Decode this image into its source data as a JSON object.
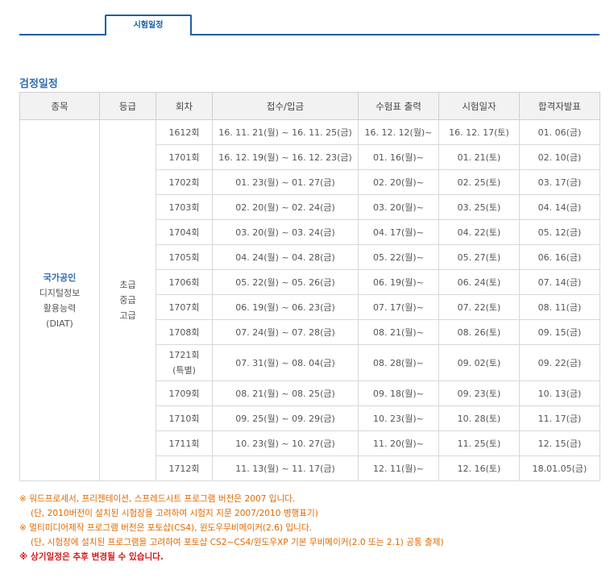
{
  "tab": {
    "label": "시험일정"
  },
  "section": {
    "title": "검정일정"
  },
  "table": {
    "headers": [
      "종목",
      "등급",
      "회차",
      "접수/입금",
      "수험표 출력",
      "시험일자",
      "합격자발표"
    ],
    "category": {
      "line1": "국가공인",
      "line2": "디지털정보",
      "line3": "활용능력",
      "line4": "(DIAT)"
    },
    "grade": {
      "line1": "초급",
      "line2": "중급",
      "line3": "고급"
    },
    "rows": [
      {
        "round": "1612회",
        "round2": "",
        "reg": "16. 11. 21(월) ~ 16. 11. 25(금)",
        "ticket": "16. 12. 12(월)~",
        "exam": "16. 12. 17(토)",
        "result": "01. 06(금)"
      },
      {
        "round": "1701회",
        "round2": "",
        "reg": "16. 12. 19(월) ~ 16. 12. 23(금)",
        "ticket": "01. 16(월)~",
        "exam": "01. 21(토)",
        "result": "02. 10(금)"
      },
      {
        "round": "1702회",
        "round2": "",
        "reg": "01. 23(월) ~ 01. 27(금)",
        "ticket": "02. 20(월)~",
        "exam": "02. 25(토)",
        "result": "03. 17(금)"
      },
      {
        "round": "1703회",
        "round2": "",
        "reg": "02. 20(월) ~ 02. 24(금)",
        "ticket": "03. 20(월)~",
        "exam": "03. 25(토)",
        "result": "04. 14(금)"
      },
      {
        "round": "1704회",
        "round2": "",
        "reg": "03. 20(월) ~ 03. 24(금)",
        "ticket": "04. 17(월)~",
        "exam": "04. 22(토)",
        "result": "05. 12(금)"
      },
      {
        "round": "1705회",
        "round2": "",
        "reg": "04. 24(월) ~ 04. 28(금)",
        "ticket": "05. 22(월)~",
        "exam": "05. 27(토)",
        "result": "06. 16(금)"
      },
      {
        "round": "1706회",
        "round2": "",
        "reg": "05. 22(월) ~ 05. 26(금)",
        "ticket": "06. 19(월)~",
        "exam": "06. 24(토)",
        "result": "07. 14(금)"
      },
      {
        "round": "1707회",
        "round2": "",
        "reg": "06. 19(월) ~ 06. 23(금)",
        "ticket": "07. 17(월)~",
        "exam": "07. 22(토)",
        "result": "08. 11(금)"
      },
      {
        "round": "1708회",
        "round2": "",
        "reg": "07. 24(월) ~ 07. 28(금)",
        "ticket": "08. 21(월)~",
        "exam": "08. 26(토)",
        "result": "09. 15(금)"
      },
      {
        "round": "1721회",
        "round2": "(특별)",
        "reg": "07. 31(월) ~ 08. 04(금)",
        "ticket": "08. 28(월)~",
        "exam": "09. 02(토)",
        "result": "09. 22(금)"
      },
      {
        "round": "1709회",
        "round2": "",
        "reg": "08. 21(월) ~ 08. 25(금)",
        "ticket": "09. 18(월)~",
        "exam": "09. 23(토)",
        "result": "10. 13(금)"
      },
      {
        "round": "1710회",
        "round2": "",
        "reg": "09. 25(월) ~ 09. 29(금)",
        "ticket": "10. 23(월)~",
        "exam": "10. 28(토)",
        "result": "11. 17(금)"
      },
      {
        "round": "1711회",
        "round2": "",
        "reg": "10. 23(월) ~ 10. 27(금)",
        "ticket": "11. 20(월)~",
        "exam": "11. 25(토)",
        "result": "12. 15(금)"
      },
      {
        "round": "1712회",
        "round2": "",
        "reg": "11. 13(월) ~ 11. 17(금)",
        "ticket": "12. 11(월)~",
        "exam": "12. 16(토)",
        "result": "18.01.05(금)"
      }
    ]
  },
  "notes": {
    "n1": "※ 워드프로세서, 프리젠테이션, 스프레드시트 프로그램 버전은 2007 입니다.",
    "n1b": "(단, 2010버전이 설치된 시험장을 고려하여 시험지 지문 2007/2010 병행표기)",
    "n2": "※ 멀티미디어제작 프로그램 버전은 포토샵(CS4), 윈도우무비메이커(2.6) 입니다.",
    "n2b": "(단, 시험장에 설치된 프로그램을 고려하여 포토샵 CS2~CS4/윈도우XP 기본 무비메이커(2.0 또는 2.1) 공통 출제)",
    "n3": "※ 상기일정은 추후 변경될 수 있습니다."
  },
  "colors": {
    "accent": "#1a5fa8",
    "title": "#2f6db1",
    "note_orange": "#e06a00",
    "note_red": "#d21a1a"
  }
}
